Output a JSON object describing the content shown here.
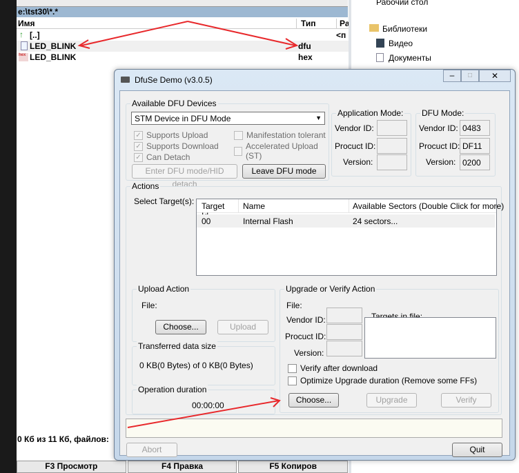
{
  "file_manager": {
    "path": "e:\\tst30\\*.*",
    "col_name": "Имя",
    "col_type": "Тип",
    "col_size": "Ра",
    "rows": [
      {
        "name": "[..]",
        "type": "",
        "size": "<п"
      },
      {
        "name": "LED_BLINK",
        "type": "dfu"
      },
      {
        "name": "LED_BLINK",
        "type": "hex"
      }
    ],
    "status": "0 Кб из 11 Кб, файлов:",
    "fkeys": [
      "F3 Просмотр",
      "F4 Правка",
      "F5 Копиров"
    ]
  },
  "explorer": {
    "items": [
      "Рабочий стол",
      "Библиотеки",
      "Видео",
      "Документы"
    ]
  },
  "dialog": {
    "title": "DfuSe Demo (v3.0.5)",
    "devices": {
      "label": "Available DFU Devices",
      "selected": "STM Device in DFU Mode",
      "supports_upload": "Supports Upload",
      "supports_download": "Supports Download",
      "can_detach": "Can Detach",
      "manifestation": "Manifestation tolerant",
      "accelerated": "Accelerated Upload (ST)",
      "enter_dfu": "Enter DFU mode/HID detach",
      "leave_dfu": "Leave DFU mode"
    },
    "app_mode": {
      "label": "Application Mode:",
      "vendor_label": "Vendor ID:",
      "product_label": "Procuct ID:",
      "version_label": "Version:"
    },
    "dfu_mode": {
      "label": "DFU Mode:",
      "vendor_label": "Vendor ID:",
      "vendor": "0483",
      "product_label": "Procuct ID:",
      "product": "DF11",
      "version_label": "Version:",
      "version": "0200"
    },
    "actions": {
      "label": "Actions",
      "select_target": "Select Target(s):",
      "columns": [
        "Target Id",
        "Name",
        "Available Sectors (Double Click for more)"
      ],
      "rows": [
        [
          "00",
          "Internal Flash",
          "24 sectors..."
        ]
      ]
    },
    "upload": {
      "label": "Upload Action",
      "file": "File:",
      "choose": "Choose...",
      "upload": "Upload"
    },
    "transferred": {
      "label": "Transferred data size",
      "value": "0 KB(0 Bytes) of 0 KB(0 Bytes)"
    },
    "duration": {
      "label": "Operation duration",
      "value": "00:00:00"
    },
    "upgrade": {
      "label": "Upgrade or Verify Action",
      "file": "File:",
      "vendor_label": "Vendor ID:",
      "product_label": "Procuct ID:",
      "version_label": "Version:",
      "targets_label": "Targets in file:",
      "verify_after": "Verify after download",
      "optimize": "Optimize Upgrade duration (Remove some FFs)",
      "choose": "Choose...",
      "upgrade": "Upgrade",
      "verify": "Verify"
    },
    "abort": "Abort",
    "quit": "Quit"
  }
}
